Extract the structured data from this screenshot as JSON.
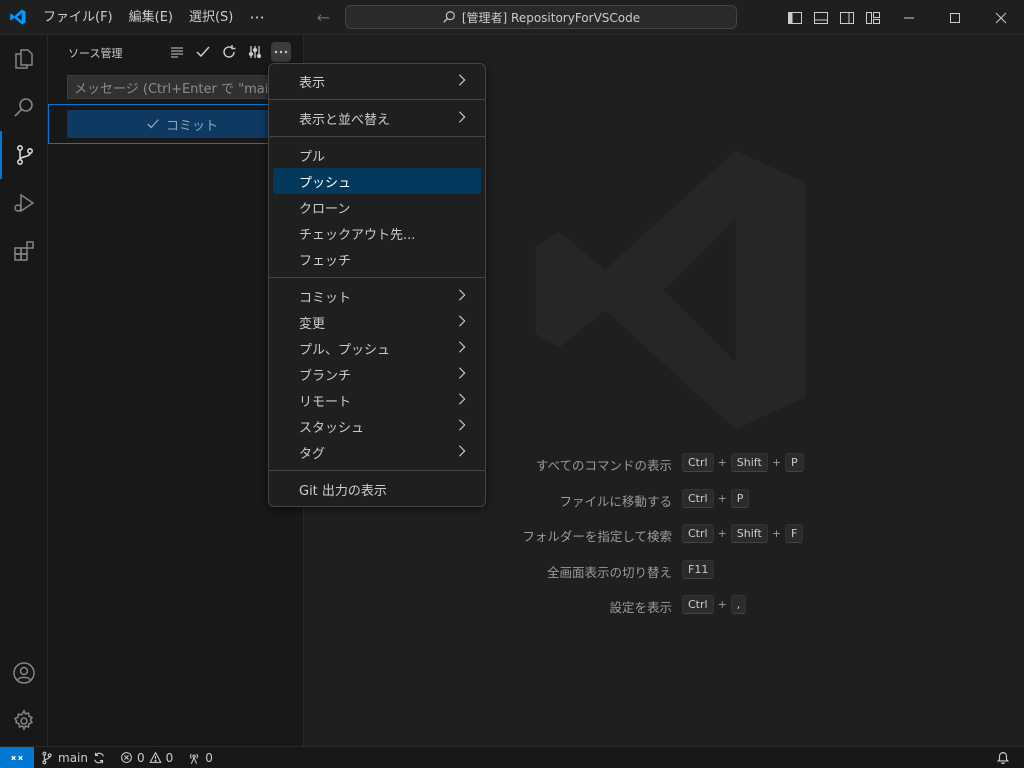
{
  "titlebar": {
    "menus": [
      "ファイル(F)",
      "編集(E)",
      "選択(S)"
    ],
    "more": "···",
    "search_text": "[管理者] RepositoryForVSCode",
    "logo_color": "#0098ff"
  },
  "activitybar": {
    "items": [
      "explorer-icon",
      "search-icon",
      "source-control-icon",
      "run-debug-icon",
      "extensions-icon"
    ],
    "bottom": [
      "account-icon",
      "settings-gear-icon"
    ]
  },
  "sidebar": {
    "title": "ソース管理",
    "message_placeholder": "メッセージ (Ctrl+Enter で \"main\"",
    "commit_label": "コミット"
  },
  "context_menu": {
    "groups": [
      [
        {
          "label": "表示",
          "submenu": true
        }
      ],
      [
        {
          "label": "表示と並べ替え",
          "submenu": true
        }
      ],
      [
        {
          "label": "プル",
          "submenu": false
        },
        {
          "label": "プッシュ",
          "submenu": false,
          "active": true
        },
        {
          "label": "クローン",
          "submenu": false
        },
        {
          "label": "チェックアウト先...",
          "submenu": false
        },
        {
          "label": "フェッチ",
          "submenu": false
        }
      ],
      [
        {
          "label": "コミット",
          "submenu": true
        },
        {
          "label": "変更",
          "submenu": true
        },
        {
          "label": "プル、プッシュ",
          "submenu": true
        },
        {
          "label": "ブランチ",
          "submenu": true
        },
        {
          "label": "リモート",
          "submenu": true
        },
        {
          "label": "スタッシュ",
          "submenu": true
        },
        {
          "label": "タグ",
          "submenu": true
        }
      ],
      [
        {
          "label": "Git 出力の表示",
          "submenu": false
        }
      ]
    ]
  },
  "shortcuts": [
    {
      "label": "すべてのコマンドの表示",
      "keys": [
        "Ctrl",
        "Shift",
        "P"
      ]
    },
    {
      "label": "ファイルに移動する",
      "keys": [
        "Ctrl",
        "P"
      ]
    },
    {
      "label": "フォルダーを指定して検索",
      "keys": [
        "Ctrl",
        "Shift",
        "F"
      ]
    },
    {
      "label": "全画面表示の切り替え",
      "keys": [
        "F11"
      ]
    },
    {
      "label": "設定を表示",
      "keys": [
        "Ctrl",
        ","
      ]
    }
  ],
  "statusbar": {
    "branch": "main",
    "errors": "0",
    "warnings": "0",
    "ports": "0",
    "accent": "#0078d4"
  }
}
